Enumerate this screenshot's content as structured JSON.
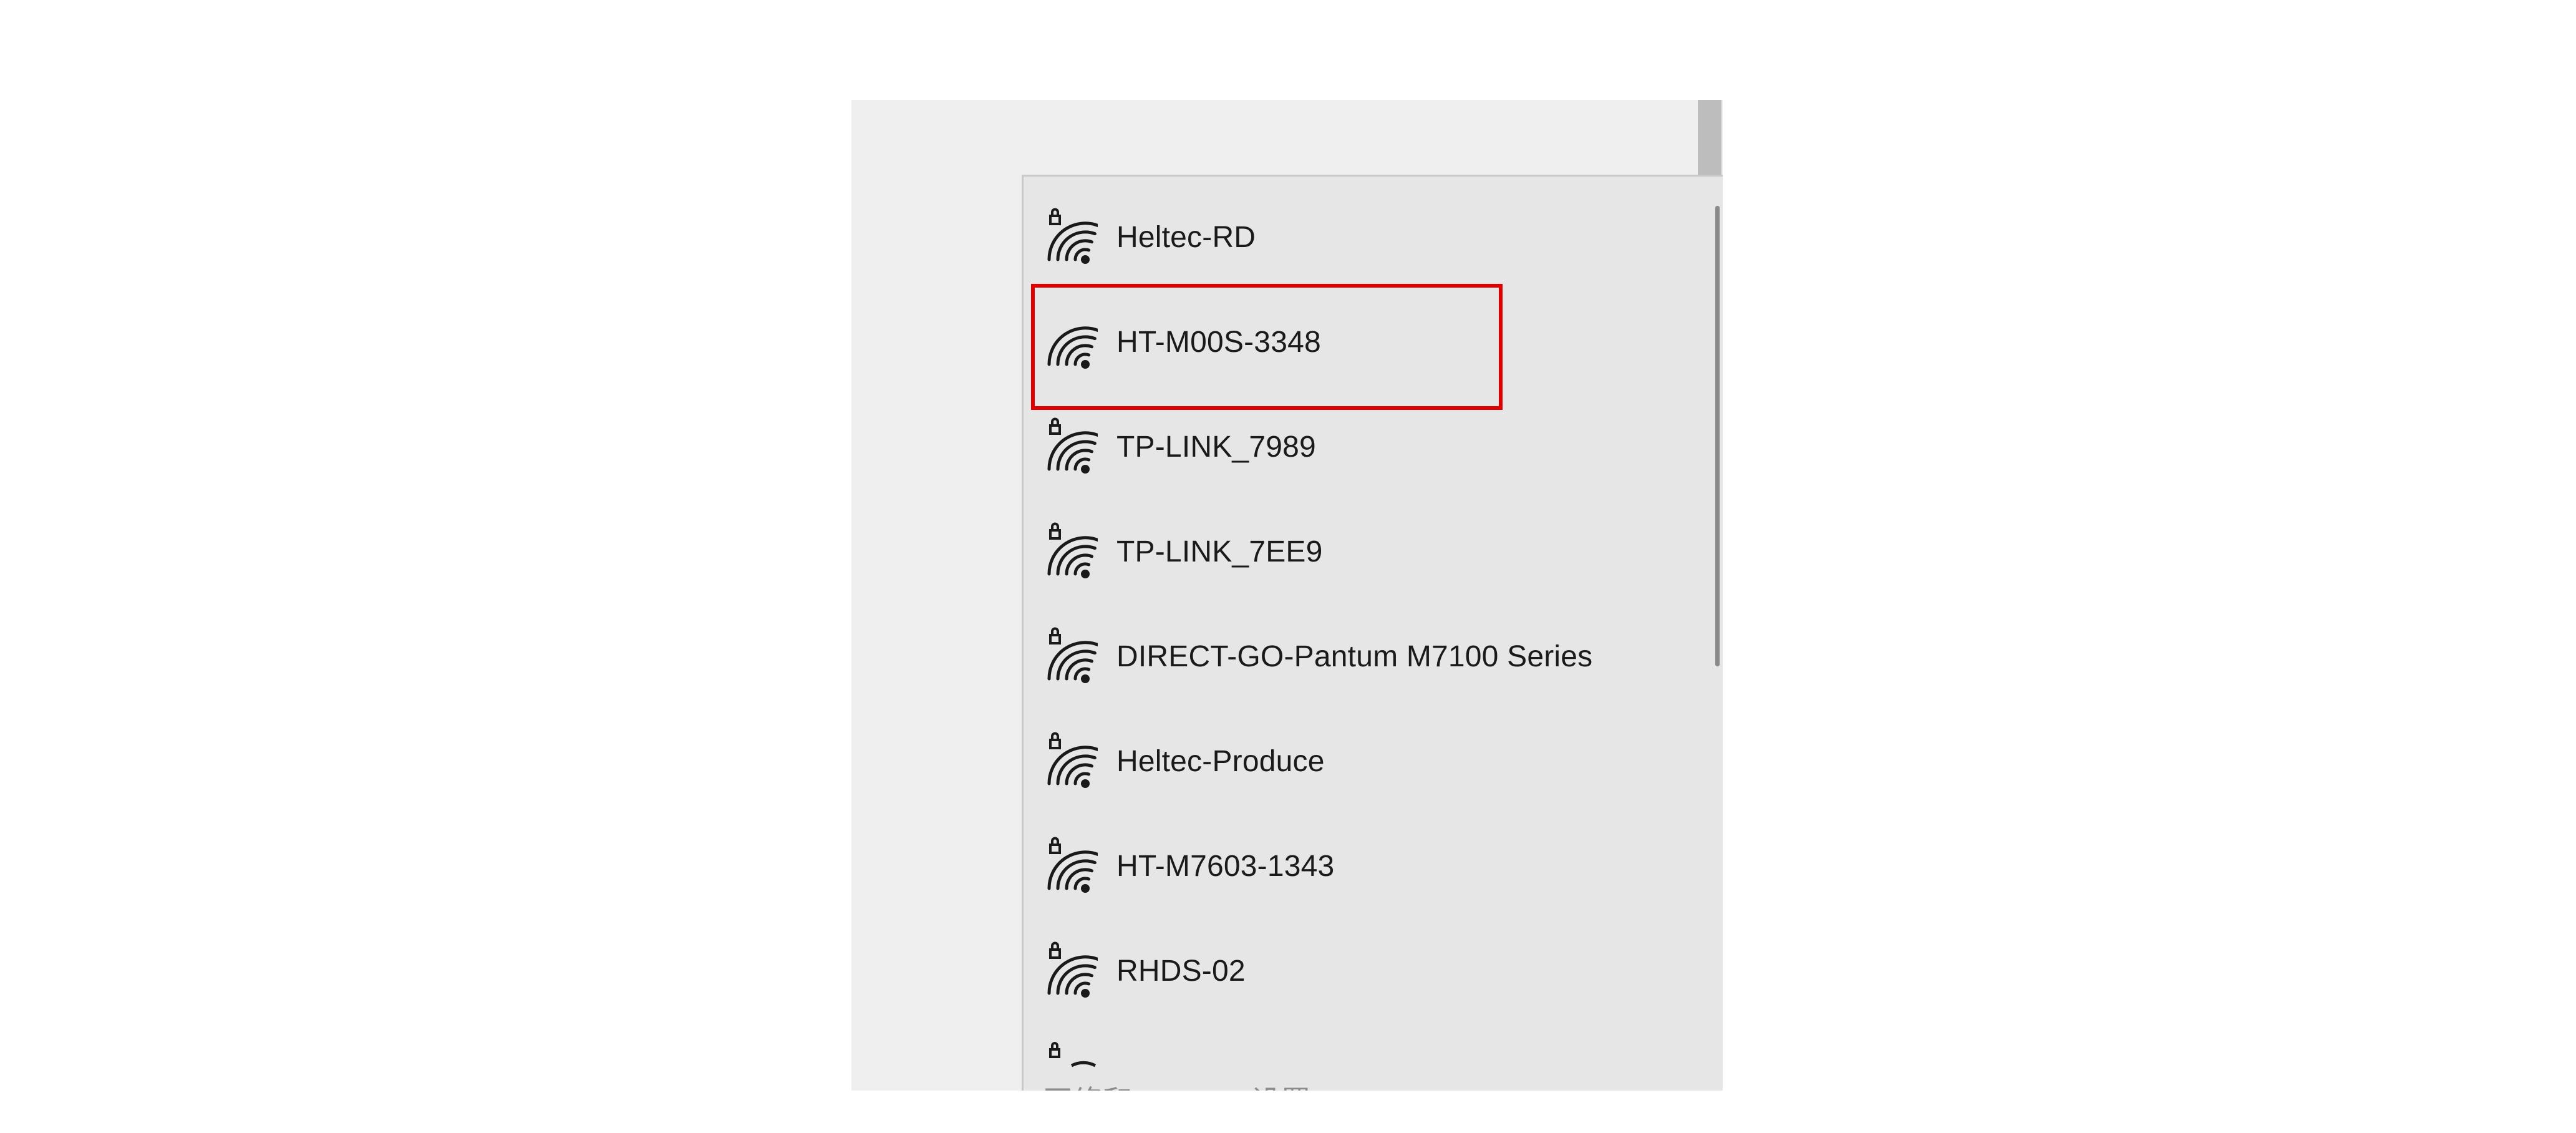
{
  "wifi_list": {
    "networks": [
      {
        "name": "Heltec-RD",
        "secured": true
      },
      {
        "name": "HT-M00S-3348",
        "secured": false,
        "highlighted": true
      },
      {
        "name": "TP-LINK_7989",
        "secured": true
      },
      {
        "name": "TP-LINK_7EE9",
        "secured": true
      },
      {
        "name": "DIRECT-GO-Pantum M7100 Series",
        "secured": true
      },
      {
        "name": "Heltec-Produce",
        "secured": true
      },
      {
        "name": "HT-M7603-1343",
        "secured": true
      },
      {
        "name": "RHDS-02",
        "secured": true
      }
    ]
  },
  "footer": {
    "settings_text": "网络和 Internet 设置"
  },
  "icons": {
    "wifi": "wifi-signal-icon",
    "lock": "lock-icon"
  },
  "colors": {
    "highlight": "#e00000",
    "list_background": "#e6e6e6",
    "panel_background": "#efefef"
  }
}
